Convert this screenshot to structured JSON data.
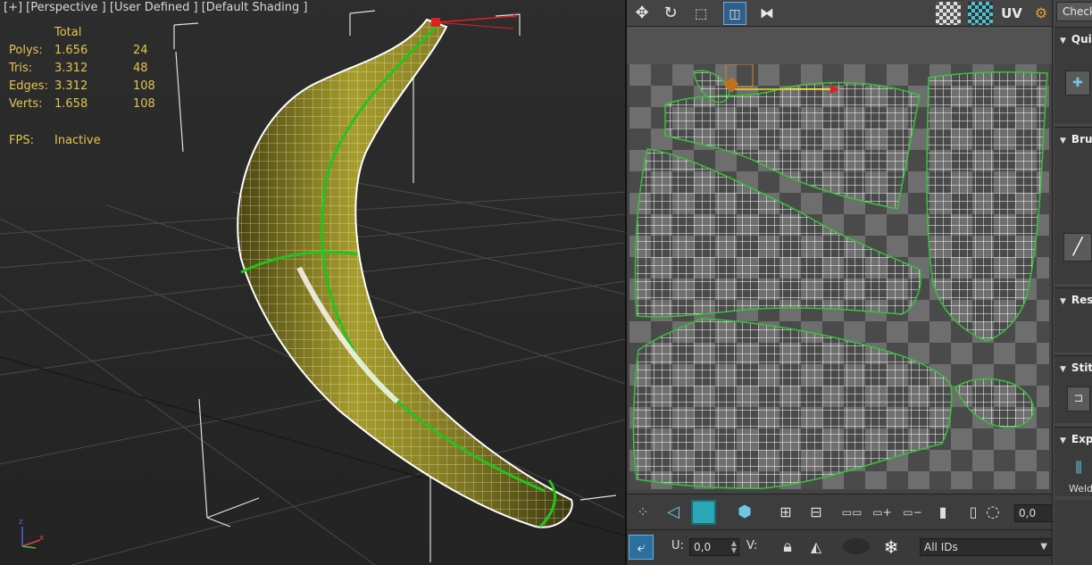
{
  "viewport": {
    "label": "[+] [Perspective ] [User Defined ] [Default Shading ]",
    "stats": {
      "header": "Total",
      "rows": [
        {
          "name": "Polys:",
          "total": "1.656",
          "sel": "24"
        },
        {
          "name": "Tris:",
          "total": "3.312",
          "sel": "48"
        },
        {
          "name": "Edges:",
          "total": "3.312",
          "sel": "108"
        },
        {
          "name": "Verts:",
          "total": "1.658",
          "sel": "108"
        }
      ],
      "fps_label": "FPS:",
      "fps_value": "Inactive"
    },
    "axis": {
      "z": "z",
      "x": "x"
    },
    "colors": {
      "stats": "#e3c54f",
      "mesh": "#b6ae2e",
      "seam": "#22c41e",
      "wire": "#ffffff"
    }
  },
  "uv_editor": {
    "toolbar_icons": [
      "move-icon",
      "rotate-icon",
      "scale-icon",
      "freeform-icon",
      "mirror-icon",
      "checker-icon",
      "checker2-icon"
    ],
    "uv_label": "UV",
    "bottom": {
      "u_label": "U:",
      "u_value": "0,0",
      "v_label": "V:",
      "weld_value": "0,0",
      "ids_value": "All IDs"
    }
  },
  "rollouts": {
    "check_button": "Check",
    "sections": [
      {
        "label": "Quick"
      },
      {
        "label": "Brush"
      },
      {
        "label": "Reshape"
      },
      {
        "label": "Stitch"
      },
      {
        "label": "Explode"
      }
    ],
    "weld_label": "Weld"
  }
}
